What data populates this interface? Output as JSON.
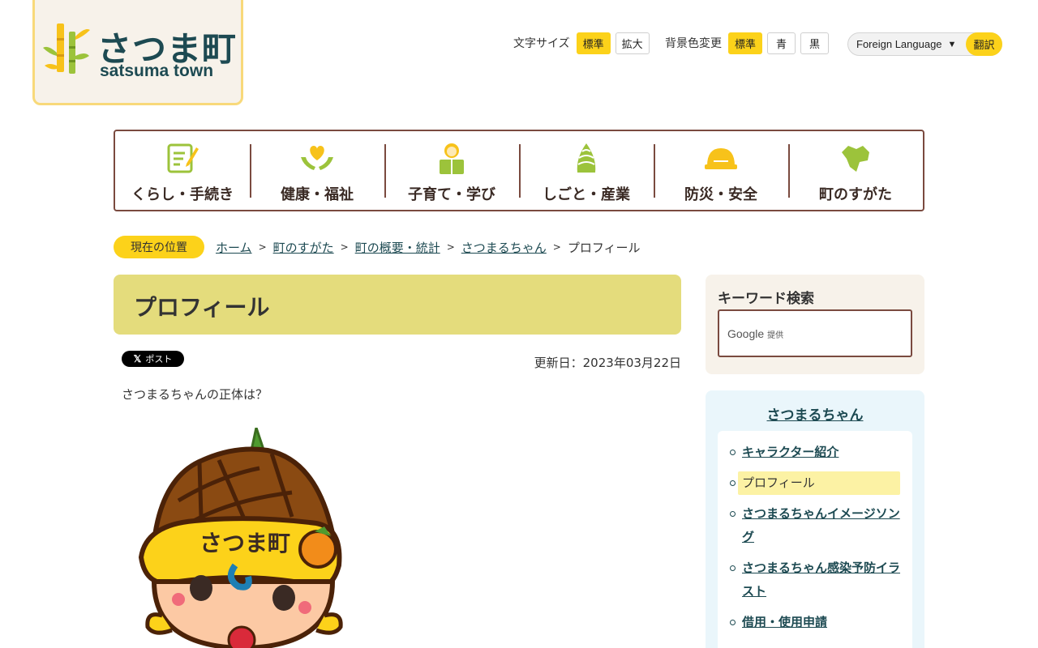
{
  "logo": {
    "name_jp": "さつま町",
    "name_en": "satsuma town"
  },
  "utility": {
    "font_size_label": "文字サイズ",
    "font_size_standard": "標準",
    "font_size_large": "拡大",
    "bg_label": "背景色変更",
    "bg_standard": "標準",
    "bg_blue": "青",
    "bg_black": "黒",
    "language_select": "Foreign Language",
    "translate_button": "翻訳"
  },
  "nav": {
    "items": [
      {
        "label": "くらし・手続き",
        "icon": "document-pen-icon"
      },
      {
        "label": "健康・福祉",
        "icon": "heart-hands-icon"
      },
      {
        "label": "子育て・学び",
        "icon": "child-reading-icon"
      },
      {
        "label": "しごと・産業",
        "icon": "bamboo-shoot-icon"
      },
      {
        "label": "防災・安全",
        "icon": "helmet-icon"
      },
      {
        "label": "町のすがた",
        "icon": "town-map-icon"
      }
    ]
  },
  "breadcrumb": {
    "here_label": "現在の位置",
    "items": [
      "ホーム",
      "町のすがた",
      "町の概要・統計",
      "さつまるちゃん"
    ],
    "current": "プロフィール"
  },
  "page": {
    "title": "プロフィール",
    "x_post_label": "ポスト",
    "updated": "更新日：2023年03月22日",
    "intro": "さつまるちゃんの正体は？",
    "mascot_hat_text": "さつま町"
  },
  "search": {
    "heading": "キーワード検索",
    "google_label": "Google",
    "google_suffix": "提供"
  },
  "side_menu": {
    "heading": "さつまるちゃん",
    "items": [
      "キャラクター紹介",
      "プロフィール",
      "さつまるちゃんイメージソング",
      "さつまるちゃん感染予防イラスト",
      "借用・使用申請"
    ]
  },
  "colors": {
    "accent_yellow": "#fcd21a",
    "brand_dark": "#1d4a52",
    "nav_border": "#7a4a3f",
    "title_bg": "#e4dc7c"
  }
}
